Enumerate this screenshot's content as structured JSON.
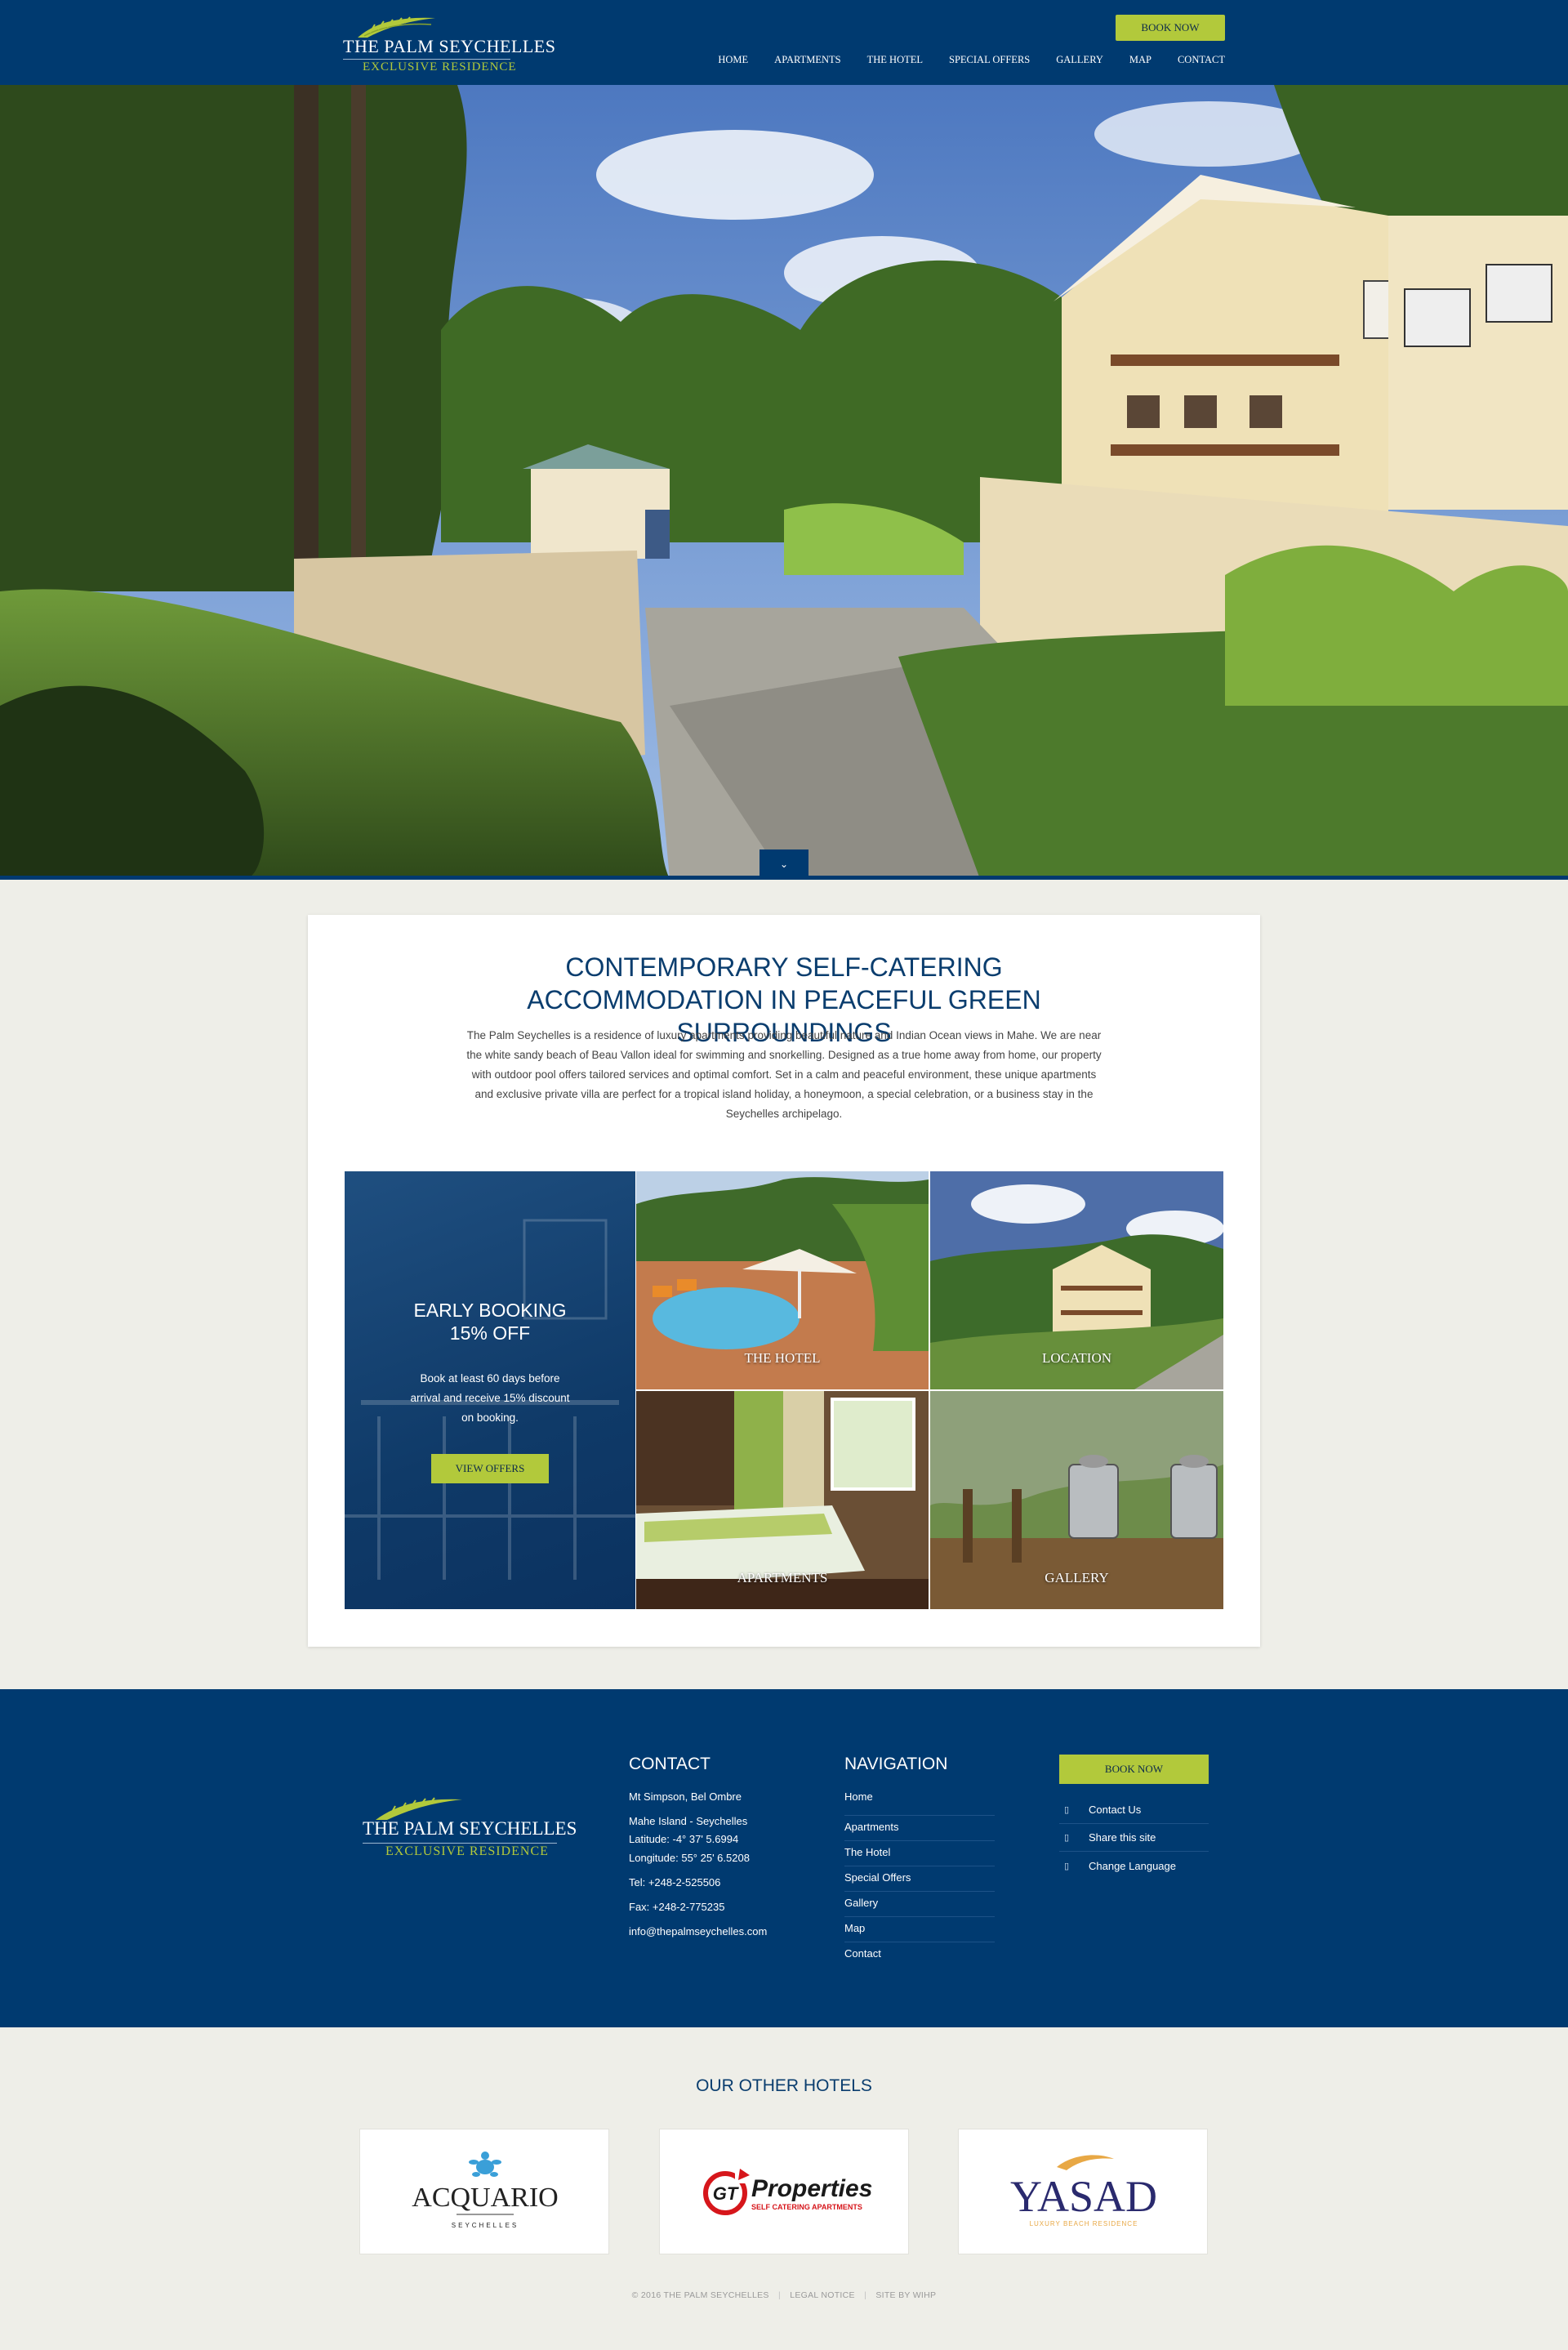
{
  "header": {
    "logo_name": "THE PALM SEYCHELLES",
    "logo_sub": "EXCLUSIVE RESIDENCE",
    "book_now": "BOOK NOW",
    "nav": [
      "HOME",
      "APARTMENTS",
      "THE HOTEL",
      "SPECIAL OFFERS",
      "GALLERY",
      "MAP",
      "CONTACT"
    ]
  },
  "hero": {
    "scroll_icon": "chevron-down-icon",
    "scroll_glyph": "⌄"
  },
  "intro": {
    "title": "CONTEMPORARY SELF-CATERING ACCOMMODATION IN PEACEFUL GREEN SURROUNDINGS",
    "text": "The Palm Seychelles is a residence of luxury apartments providing beautiful nature and Indian Ocean views in Mahe. We are near the white sandy beach of Beau Vallon ideal for swimming and snorkelling. Designed as a true home away from home, our property with outdoor pool offers tailored services and optimal comfort. Set in a calm and peaceful environment, these unique apartments and exclusive private villa are perfect for a tropical island holiday, a honeymoon, a special celebration, or a business stay in the Seychelles archipelago."
  },
  "promo": {
    "title_line1": "EARLY BOOKING",
    "title_line2": "15% OFF",
    "text": "Book at least 60 days before arrival and receive 15% discount on booking.",
    "button": "VIEW OFFERS"
  },
  "tiles": {
    "hotel": "THE HOTEL",
    "location": "LOCATION",
    "apartments": "APARTMENTS",
    "gallery": "GALLERY"
  },
  "footer": {
    "logo_name": "THE PALM SEYCHELLES",
    "logo_sub": "EXCLUSIVE RESIDENCE",
    "contact_title": "CONTACT",
    "contact": {
      "address1": "Mt Simpson, Bel Ombre",
      "address2": "Mahe Island - Seychelles",
      "latitude": "Latitude: -4° 37' 5.6994",
      "longitude": "Longitude: 55° 25' 6.5208",
      "tel": "Tel: +248-2-525506",
      "fax": "Fax: +248-2-775235",
      "email": "info@thepalmseychelles.com"
    },
    "navigation_title": "NAVIGATION",
    "navigation": [
      "Home",
      "Apartments",
      "The Hotel",
      "Special Offers",
      "Gallery",
      "Map",
      "Contact"
    ],
    "book_now": "BOOK NOW",
    "links": [
      {
        "label": "Contact Us",
        "icon": "envelope-icon"
      },
      {
        "label": "Share this site",
        "icon": "share-icon"
      },
      {
        "label": "Change Language",
        "icon": "globe-icon"
      }
    ],
    "link_glyph": "▯"
  },
  "other_hotels": {
    "title": "OUR OTHER HOTELS",
    "acquario": {
      "name": "ACQUARIO",
      "sub": "SEYCHELLES"
    },
    "gt": {
      "mark": "GT",
      "name": "Properties",
      "sub": "SELF CATERING APARTMENTS"
    },
    "yasad": {
      "name": "YASAD",
      "sub": "LUXURY BEACH RESIDENCE"
    }
  },
  "copyright": {
    "text": "© 2016 THE PALM SEYCHELLES",
    "legal": "LEGAL NOTICE",
    "site_by": "SITE BY WIHP"
  },
  "colors": {
    "navy": "#003a70",
    "accent_green": "#b2c93b",
    "background": "#eeeee8"
  }
}
